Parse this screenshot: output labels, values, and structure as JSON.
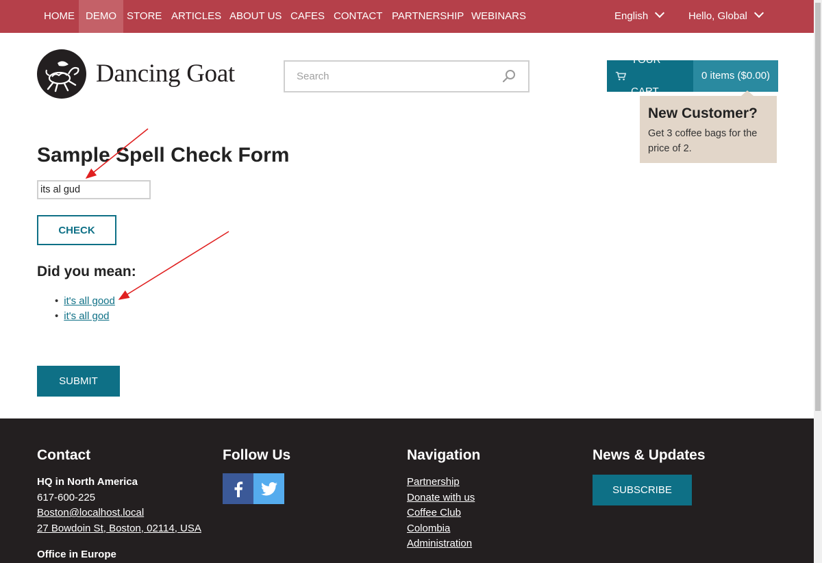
{
  "topnav": {
    "items": [
      "HOME",
      "DEMO",
      "STORE",
      "ARTICLES",
      "ABOUT US",
      "CAFES",
      "CONTACT",
      "PARTNERSHIP",
      "WEBINARS"
    ],
    "active": "DEMO",
    "language": "English",
    "greeting": "Hello, Global"
  },
  "header": {
    "logo_text": "Dancing Goat",
    "search_placeholder": "Search",
    "cart_label": "YOUR CART",
    "cart_summary": "0 items ($0.00)"
  },
  "promo": {
    "title": "New Customer?",
    "text": "Get 3 coffee bags for the price of 2."
  },
  "form": {
    "title": "Sample Spell Check Form",
    "input_value": "its al gud",
    "check_label": "CHECK",
    "did_you_mean": "Did you mean:",
    "suggestions": [
      "it's all good",
      "it's all god"
    ],
    "submit_label": "SUBMIT"
  },
  "footer": {
    "contact": {
      "heading": "Contact",
      "hq_title": "HQ in North America",
      "phone": "617-600-225",
      "email": "Boston@localhost.local",
      "address": "27 Bowdoin St, Boston, 02114, USA",
      "europe_title": "Office in Europe"
    },
    "follow": {
      "heading": "Follow Us"
    },
    "navigation": {
      "heading": "Navigation",
      "links": [
        "Partnership",
        "Donate with us",
        "Coffee Club",
        "Colombia",
        "Administration"
      ]
    },
    "news": {
      "heading": "News & Updates",
      "subscribe_label": "SUBSCRIBE"
    }
  },
  "colors": {
    "nav_bg": "#b5404a",
    "accent": "#0e7086",
    "footer_bg": "#231f20",
    "promo_bg": "#e2d6c9",
    "annotation_arrow": "#e02020"
  },
  "icons": [
    "goat-logo-icon",
    "search-icon",
    "cart-icon",
    "chevron-down-icon",
    "facebook-icon",
    "twitter-icon"
  ]
}
